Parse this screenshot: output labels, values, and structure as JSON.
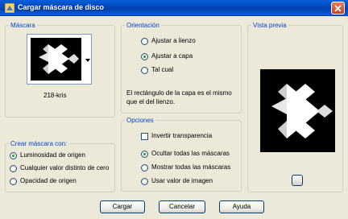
{
  "window": {
    "title": "Cargar máscara de disco"
  },
  "mask_group": {
    "legend": "Máscara",
    "mask_name": "218-kris"
  },
  "create_group": {
    "legend": "Crear máscara con:",
    "options": [
      {
        "label": "Luminosidad de origen",
        "selected": true
      },
      {
        "label": "Cualquier valor distinto de cero",
        "selected": false
      },
      {
        "label": "Opacidad de origen",
        "selected": false
      }
    ]
  },
  "orientation_group": {
    "legend": "Orientación",
    "options": [
      {
        "label": "Ajustar a lienzo",
        "selected": false
      },
      {
        "label": "Ajustar a capa",
        "selected": true
      },
      {
        "label": "Tal cual",
        "selected": false
      }
    ],
    "note_line1": "El rectángulo de la capa es el mismo",
    "note_line2": "que el del lienzo."
  },
  "options_group": {
    "legend": "Opciones",
    "invert_label": "Invertir transparencia",
    "invert_checked": false,
    "options": [
      {
        "label": "Ocultar todas las máscaras",
        "selected": true
      },
      {
        "label": "Mostrar todas las máscaras",
        "selected": false
      },
      {
        "label": "Usar valor de imagen",
        "selected": false
      }
    ]
  },
  "preview_group": {
    "legend": "Vista previa"
  },
  "buttons": {
    "load": "Cargar",
    "cancel": "Cancelar",
    "help": "Ayuda"
  },
  "colors": {
    "titlebar": "#0a5fd8",
    "legend": "#0046d5",
    "dialog_bg": "#ece9d8"
  }
}
